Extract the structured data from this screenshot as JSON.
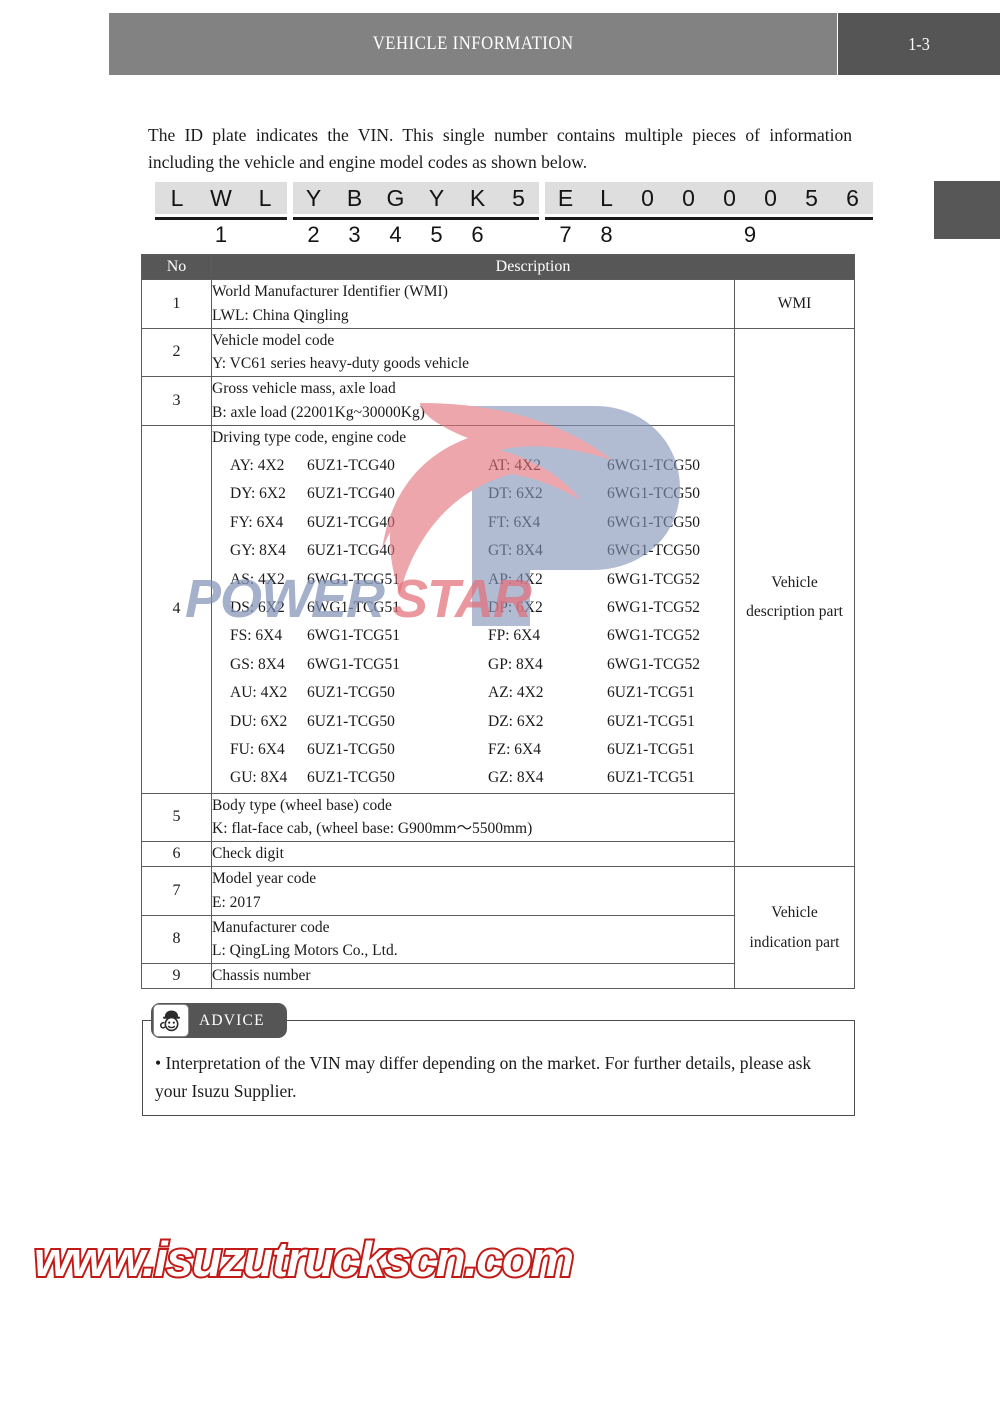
{
  "header": {
    "title": "VEHICLE INFORMATION",
    "page_number": "1-3"
  },
  "intro": {
    "paragraph": "The ID plate indicates the VIN. This single number contains multiple pieces of information including the vehicle and engine model codes as shown below."
  },
  "vin_diagram": {
    "groups": [
      {
        "chars": [
          "L",
          "W",
          "L"
        ],
        "numbers": [
          "1"
        ]
      },
      {
        "chars": [
          "Y",
          "B",
          "G",
          "Y",
          "K",
          "5"
        ],
        "numbers": [
          "2",
          "3",
          "4",
          "5",
          "6"
        ]
      },
      {
        "chars": [
          "E",
          "L",
          "0",
          "0",
          "0",
          "0",
          "5",
          "6"
        ],
        "numbers": [
          "7",
          "8",
          "9"
        ]
      }
    ]
  },
  "table": {
    "headers": {
      "no": "No",
      "description": "Description"
    },
    "rows": [
      {
        "no": "1",
        "lines": [
          "World Manufacturer Identifier (WMI)",
          "LWL: China Qingling"
        ]
      },
      {
        "no": "2",
        "lines": [
          "Vehicle model code",
          "Y: VC61 series heavy-duty goods vehicle"
        ]
      },
      {
        "no": "3",
        "lines": [
          "Gross vehicle mass, axle load",
          "B: axle load (22001Kg~30000Kg)"
        ]
      },
      {
        "no": "4",
        "lines": [
          "Driving type code, engine code"
        ]
      },
      {
        "no": "5",
        "lines": [
          "Body type (wheel base) code",
          "K: flat-face cab, (wheel base: G900mm～5500mm)"
        ]
      },
      {
        "no": "6",
        "lines": [
          "Check digit"
        ]
      },
      {
        "no": "7",
        "lines": [
          "Model year code",
          "E: 2017"
        ]
      },
      {
        "no": "8",
        "lines": [
          "Manufacturer code",
          "L: QingLing Motors Co., Ltd."
        ]
      },
      {
        "no": "9",
        "lines": [
          "Chassis number"
        ]
      }
    ],
    "engine_codes": [
      [
        "AY: 4X2",
        "6UZ1-TCG40",
        "AT: 4X2",
        "6WG1-TCG50"
      ],
      [
        "DY: 6X2",
        "6UZ1-TCG40",
        "DT: 6X2",
        "6WG1-TCG50"
      ],
      [
        "FY: 6X4",
        "6UZ1-TCG40",
        "FT: 6X4",
        "6WG1-TCG50"
      ],
      [
        "GY: 8X4",
        "6UZ1-TCG40",
        "GT: 8X4",
        "6WG1-TCG50"
      ],
      [
        "AS: 4X2",
        "6WG1-TCG51",
        "AP: 4X2",
        "6WG1-TCG52"
      ],
      [
        "DS: 6X2",
        "6WG1-TCG51",
        "DP: 6X2",
        "6WG1-TCG52"
      ],
      [
        "FS: 6X4",
        "6WG1-TCG51",
        "FP: 6X4",
        "6WG1-TCG52"
      ],
      [
        "GS: 8X4",
        "6WG1-TCG51",
        "GP: 8X4",
        "6WG1-TCG52"
      ],
      [
        "AU: 4X2",
        "6UZ1-TCG50",
        "AZ: 4X2",
        "6UZ1-TCG51"
      ],
      [
        "DU: 6X2",
        "6UZ1-TCG50",
        "DZ: 6X2",
        "6UZ1-TCG51"
      ],
      [
        "FU: 6X4",
        "6UZ1-TCG50",
        "FZ: 6X4",
        "6UZ1-TCG51"
      ],
      [
        "GU: 8X4",
        "6UZ1-TCG50",
        "GZ: 8X4",
        "6UZ1-TCG51"
      ]
    ],
    "part_labels": {
      "wmi": "WMI",
      "description_part_line1": "Vehicle",
      "description_part_line2": "description part",
      "indication_part_line1": "Vehicle",
      "indication_part_line2": "indication part"
    }
  },
  "advice": {
    "label": "ADVICE",
    "text": "• Interpretation of the VIN may differ depending on the market. For further details, please ask your Isuzu Supplier."
  },
  "watermarks": {
    "brand_first": "POWER",
    "brand_second": "STAR",
    "url": "www.isuzutruckscn.com"
  },
  "colors": {
    "header_bar": "#828282",
    "header_page_bar": "#555555",
    "table_header": "#575757",
    "vin_chip": "#dedede",
    "brand_blue": "#8393b8",
    "brand_red": "#e2707a",
    "url_red": "#c21b17"
  }
}
